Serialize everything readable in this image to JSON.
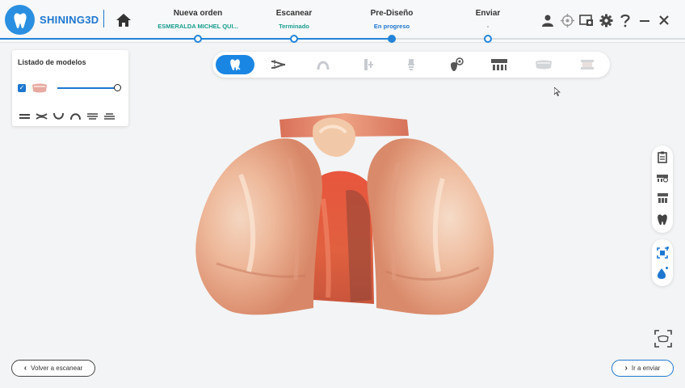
{
  "app": {
    "brand": "SHINING3D",
    "accent_color": "#1d77d0",
    "icons": {
      "logo": "tooth-logo-icon",
      "home": "home-icon"
    }
  },
  "steps": [
    {
      "title": "Nueva orden",
      "sub": "ESMERALDA MICHEL QUI...",
      "state": "done"
    },
    {
      "title": "Escanear",
      "sub": "Terminado",
      "state": "done"
    },
    {
      "title": "Pre-Diseño",
      "sub": "En progreso",
      "state": "current"
    },
    {
      "title": "Enviar",
      "sub": "-",
      "state": "pending"
    }
  ],
  "top_icons": [
    "user-icon",
    "target-icon",
    "screen-record-icon",
    "settings-icon",
    "help-icon",
    "minimize-icon",
    "close-icon"
  ],
  "model_panel": {
    "title": "Listado de modelos",
    "checked": true,
    "opacity_level": 1.0,
    "shape_icons": [
      "upper-jaw-icon",
      "bite-icon",
      "lower-arch-icon",
      "arch-icon",
      "upper-shell-icon",
      "lower-shell-icon"
    ]
  },
  "toolbar": {
    "tools": [
      "tooth-select-icon",
      "trim-icon",
      "arch-icon",
      "tooth-adjust-icon",
      "abutment-icon",
      "inspect-icon",
      "model-base-icon",
      "denture-icon",
      "articulator-icon"
    ],
    "active_index": 0
  },
  "right_tools": {
    "group1": [
      "clipboard-icon",
      "scan-match-icon",
      "grid-model-icon",
      "tooth-icon"
    ],
    "group2": [
      "ai-fill-icon",
      "color-drop-icon"
    ]
  },
  "buttons": {
    "back": "Volver a escanear",
    "next": "Ir a enviar"
  }
}
